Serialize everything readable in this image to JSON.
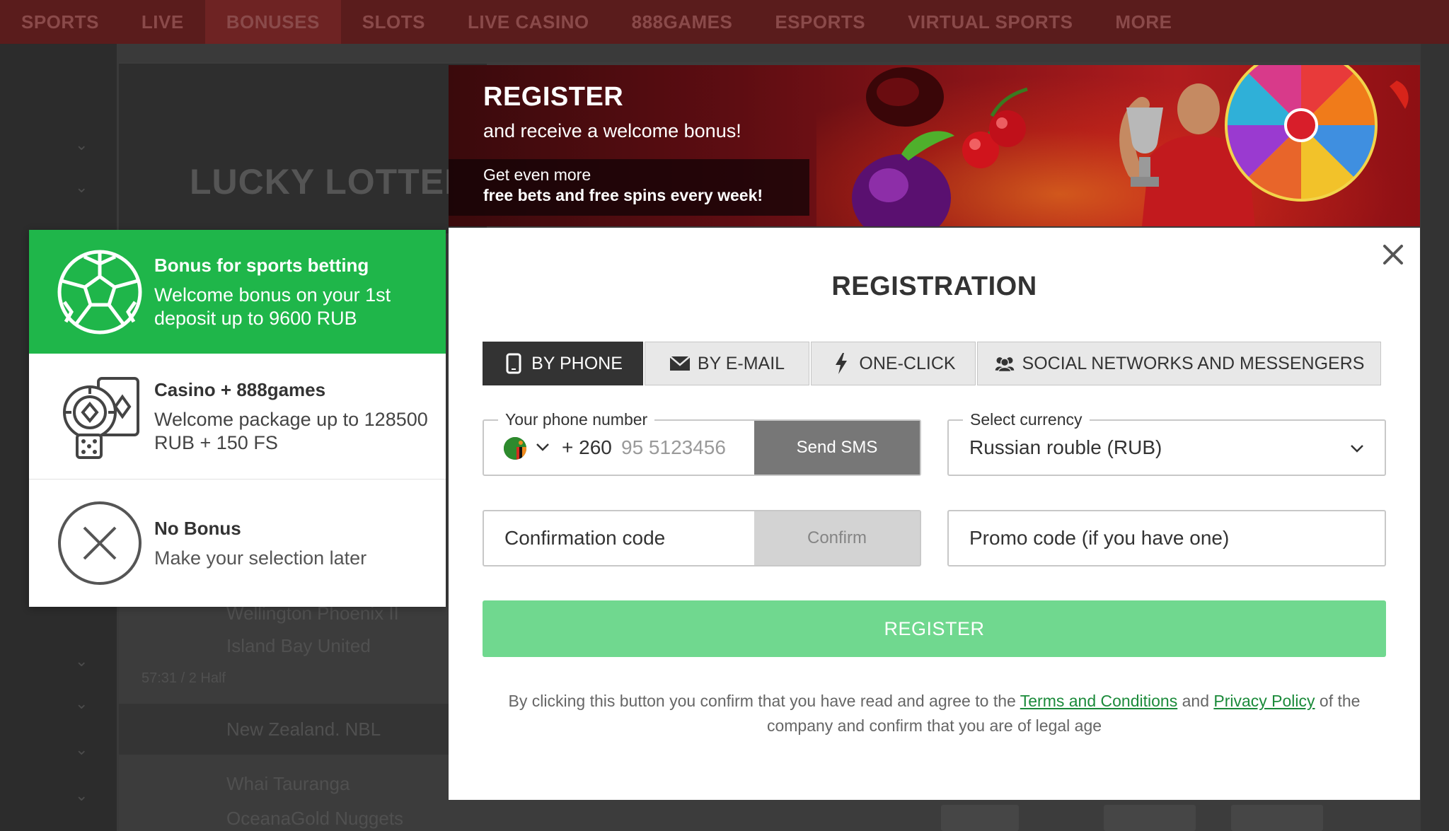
{
  "background": {
    "nav": [
      "SPORTS",
      "LIVE",
      "BONUSES",
      "SLOTS",
      "LIVE CASINO",
      "888GAMES",
      "ESPORTS",
      "VIRTUAL SPORTS",
      "MORE"
    ],
    "lottery_title": "LUCKY LOTTERY",
    "rows": [
      "Wellington Phoenix II",
      "Island Bay United",
      "57:31 / 2 Half",
      "New Zealand. NBL",
      "Whai Tauranga",
      "OceanaGold Nuggets"
    ]
  },
  "bonus_panel": {
    "options": [
      {
        "title": "Bonus for sports betting",
        "description": "Welcome bonus on your 1st deposit up to 9600 RUB",
        "icon": "soccer-ball-icon",
        "selected": true
      },
      {
        "title": "Casino + 888games",
        "description": "Welcome package up to 128500 RUB + 150 FS",
        "icon": "casino-chip-icon",
        "selected": false
      },
      {
        "title": "No Bonus",
        "description": "Make your selection later",
        "icon": "no-bonus-x-icon",
        "selected": false
      }
    ]
  },
  "banner": {
    "title": "REGISTER",
    "subtitle": "and receive a welcome bonus!",
    "promo_line1": "Get even more",
    "promo_line2": "free bets and free spins every week!"
  },
  "modal": {
    "title": "REGISTRATION",
    "close_icon": "close-icon",
    "tabs": [
      {
        "label": "BY PHONE",
        "icon": "phone-icon",
        "active": true
      },
      {
        "label": "BY E-MAIL",
        "icon": "envelope-icon",
        "active": false
      },
      {
        "label": "ONE-CLICK",
        "icon": "lightning-icon",
        "active": false
      },
      {
        "label": "SOCIAL NETWORKS AND MESSENGERS",
        "icon": "users-icon",
        "active": false
      }
    ],
    "phone": {
      "label": "Your phone number",
      "dial_code": "+ 260",
      "placeholder": "95 5123456",
      "value": "",
      "send_sms_label": "Send SMS",
      "flag_icon": "zambia-flag-icon"
    },
    "currency": {
      "label": "Select currency",
      "value": "Russian rouble (RUB)"
    },
    "confirmation": {
      "placeholder": "Confirmation code",
      "confirm_label": "Confirm"
    },
    "promo": {
      "placeholder": "Promo code (if you have one)"
    },
    "register_label": "REGISTER",
    "legal": {
      "before": "By clicking this button you confirm that you have read and agree to the ",
      "terms_link": "Terms and Conditions",
      "middle": " and ",
      "privacy_link": "Privacy Policy",
      "after": " of the company and confirm that you are of legal age"
    }
  },
  "colors": {
    "accent_green": "#1fb64a",
    "register_button": "#70d88f",
    "active_tab": "#333333",
    "link_green": "#1b8a3a",
    "banner_red": "#8a1418"
  }
}
